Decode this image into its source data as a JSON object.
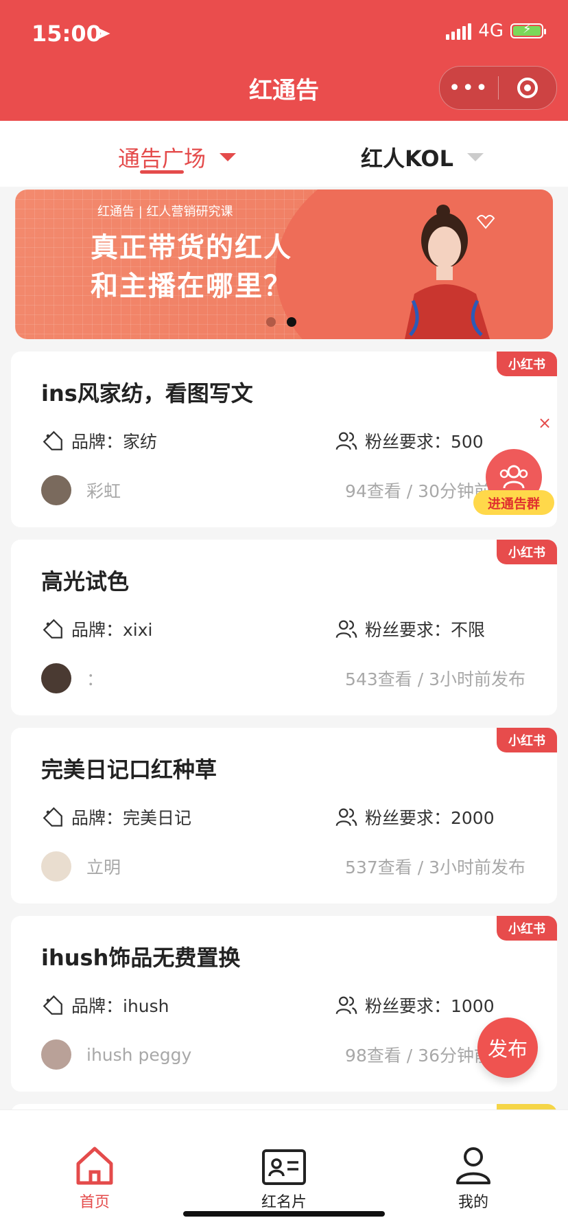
{
  "status": {
    "time": "15:00",
    "network": "4G"
  },
  "header": {
    "title": "红通告"
  },
  "tabs": [
    {
      "label": "通告广场",
      "active": true
    },
    {
      "label": "红人KOL",
      "active": false
    }
  ],
  "banner": {
    "subtitle": "红通告 | 红人营销研究课",
    "line1": "真正带货的红人",
    "line2": "和主播在哪里？",
    "slide_index": 2,
    "slide_count": 2
  },
  "cards": [
    {
      "platform": "小红书",
      "title": "ins风家纺，看图写文",
      "brand": "品牌：家纺",
      "fans": "粉丝要求：500",
      "author": "彩虹",
      "stats": "94查看 / 30分钟前发布"
    },
    {
      "platform": "小红书",
      "title": "高光试色",
      "brand": "品牌：xixi",
      "fans": "粉丝要求：不限",
      "author": "：",
      "stats": "543查看 / 3小时前发布"
    },
    {
      "platform": "小红书",
      "title": "完美日记口红种草",
      "brand": "品牌：完美日记",
      "fans": "粉丝要求：2000",
      "author": "立明",
      "stats": "537查看 / 3小时前发布"
    },
    {
      "platform": "小红书",
      "title": "ihush饰品无费置换",
      "brand": "品牌：ihush",
      "fans": "粉丝要求：1000",
      "author": "ihush peggy",
      "stats": "98查看 / 36分钟前发布"
    }
  ],
  "floating": {
    "group_label": "进通告群",
    "close": "×",
    "publish": "发布"
  },
  "nav": [
    {
      "label": "首页",
      "icon": "home-icon",
      "active": true
    },
    {
      "label": "红名片",
      "icon": "id-card-icon",
      "active": false
    },
    {
      "label": "我的",
      "icon": "user-icon",
      "active": false
    }
  ],
  "colors": {
    "brand": "#ea4d4d",
    "text": "#222222",
    "muted": "#a8a8a8",
    "badge_weibo": "#f5d547"
  }
}
